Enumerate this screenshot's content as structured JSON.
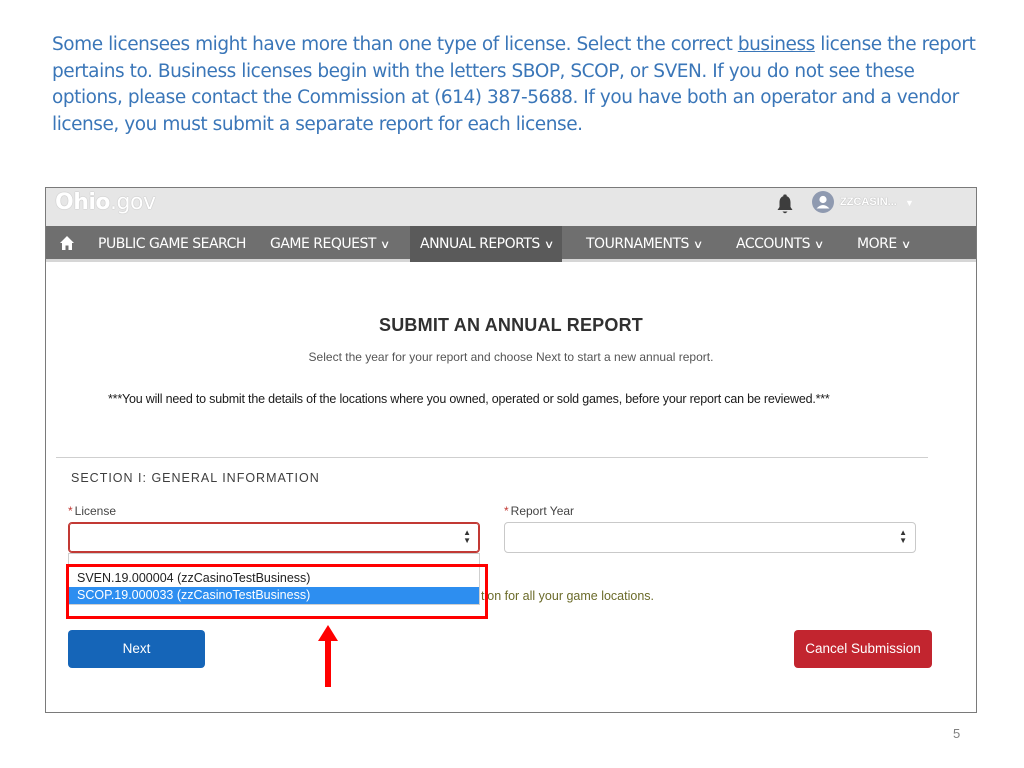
{
  "intro": {
    "part1": "Some licensees might have more than one type of license.  Select the correct ",
    "underlined": "business",
    "part2": " license the report pertains to. Business licenses begin with the letters SBOP, SCOP, or SVEN. If you do not see these options, please contact the Commission at (614) 387-5688.   If you have both an operator and a vendor license, you must submit a separate report for each license."
  },
  "header": {
    "logo_bold": "Ohio",
    "logo_rest": ".gov",
    "logo_prefix": "O",
    "user_name": "ZZCASIN...",
    "icons": {
      "notification": "bell-icon",
      "avatar": "user-avatar-icon",
      "caret": "caret-down-icon"
    }
  },
  "nav": {
    "home_icon": "home-icon",
    "items": [
      {
        "label": "PUBLIC GAME SEARCH",
        "chevron": false
      },
      {
        "label": "GAME REQUEST",
        "chevron": true
      },
      {
        "label": "ANNUAL REPORTS",
        "chevron": true,
        "active": true
      },
      {
        "label": "TOURNAMENTS",
        "chevron": true
      },
      {
        "label": "ACCOUNTS",
        "chevron": true
      },
      {
        "label": "MORE",
        "chevron": true
      }
    ]
  },
  "page": {
    "title": "SUBMIT AN ANNUAL REPORT",
    "subtitle": "Select the year for your report and choose Next to start a new annual report.",
    "notice": "***You will need to submit the details of the locations where you owned, operated or sold games, before your report can be reviewed.***",
    "section_title": "SECTION I: GENERAL INFORMATION"
  },
  "form": {
    "license_label": "License",
    "license_value": "",
    "report_year_label": "Report Year",
    "report_year_value": "",
    "required_mark": "*",
    "options": [
      {
        "label": "SVEN.19.000004 (zzCasinoTestBusiness)",
        "selected": false
      },
      {
        "label": "SCOP.19.000033 (zzCasinoTestBusiness)",
        "selected": true
      }
    ],
    "partial_hint": "tion for all your game locations."
  },
  "buttons": {
    "next": "Next",
    "cancel": "Cancel Submission"
  },
  "annotation": {
    "highlight_color": "#ff0000",
    "arrow_color": "#ff0000"
  },
  "slide": {
    "page_number": "5"
  },
  "colors": {
    "intro_text": "#3a76b8",
    "nav_bg": "#6f6f6f",
    "primary_button": "#1565b8",
    "danger_button": "#c2252f",
    "selected_option": "#2d8ef0"
  }
}
